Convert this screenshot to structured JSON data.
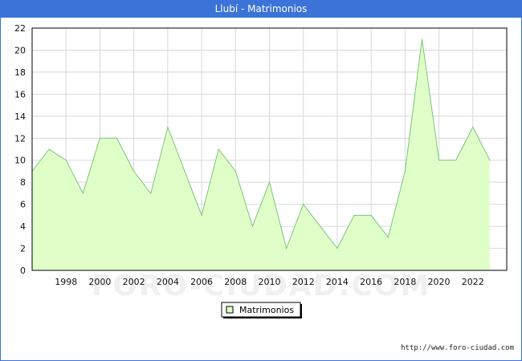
{
  "window": {
    "title": "Llubí - Matrimonios"
  },
  "footer": {
    "url": "http://www.foro-ciudad.com"
  },
  "watermark": "FORO-CIUDAD.COM",
  "colors": {
    "header_bg": "#3b73d8",
    "series_fill": "#e0ffc8",
    "series_line": "#7cc47c",
    "grid": "#d8d8d8"
  },
  "chart_data": {
    "type": "area",
    "title": "Llubí - Matrimonios",
    "xlabel": "",
    "ylabel": "",
    "xlim": [
      1996,
      2024
    ],
    "ylim": [
      0,
      22
    ],
    "x_ticks": [
      1998,
      2000,
      2002,
      2004,
      2006,
      2008,
      2010,
      2012,
      2014,
      2016,
      2018,
      2020,
      2022
    ],
    "y_ticks": [
      0,
      2,
      4,
      6,
      8,
      10,
      12,
      14,
      16,
      18,
      20,
      22
    ],
    "grid": true,
    "legend_position": "bottom-center",
    "x": [
      1996,
      1997,
      1998,
      1999,
      2000,
      2001,
      2002,
      2003,
      2004,
      2005,
      2006,
      2007,
      2008,
      2009,
      2010,
      2011,
      2012,
      2013,
      2014,
      2015,
      2016,
      2017,
      2018,
      2019,
      2020,
      2021,
      2022,
      2023
    ],
    "series": [
      {
        "name": "Matrimonios",
        "values": [
          9,
          11,
          10,
          7,
          12,
          12,
          9,
          7,
          13,
          9,
          5,
          11,
          9,
          4,
          8,
          2,
          6,
          4,
          2,
          5,
          5,
          3,
          9,
          21,
          10,
          10,
          13,
          10
        ]
      }
    ]
  }
}
